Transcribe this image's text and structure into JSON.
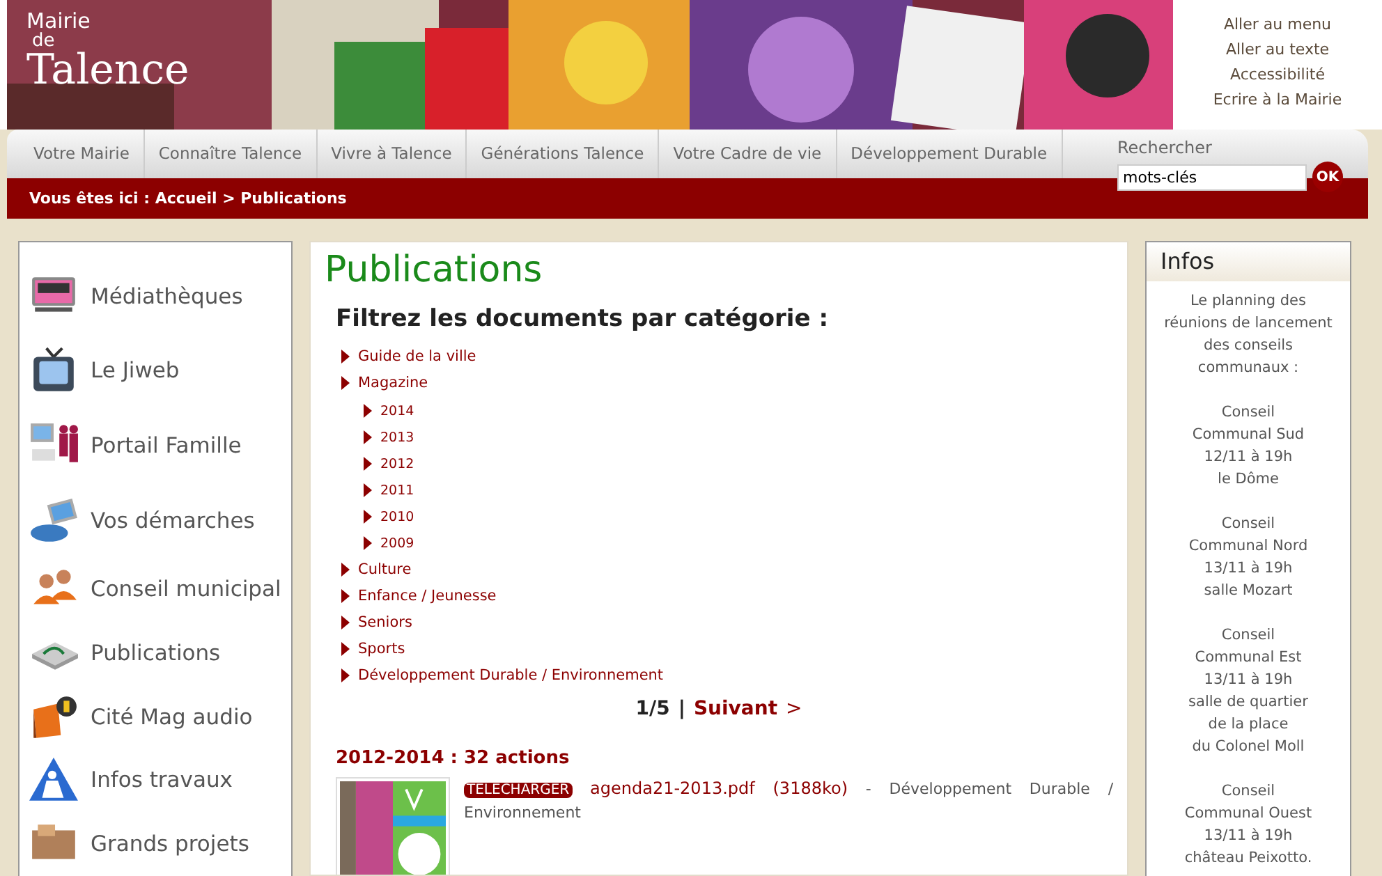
{
  "header": {
    "logo": [
      "Mairie",
      "de",
      "Talence"
    ],
    "skip_links": [
      "Aller au menu",
      "Aller au texte",
      "Accessibilité",
      "Ecrire à la Mairie"
    ]
  },
  "nav": {
    "items": [
      "Votre Mairie",
      "Connaître Talence",
      "Vivre à Talence",
      "Générations Talence",
      "Votre Cadre de vie",
      "Développement Durable"
    ],
    "search": {
      "label": "Rechercher",
      "value": "mots-clés",
      "button": "OK"
    }
  },
  "breadcrumb": {
    "prefix": "Vous êtes ici :",
    "items": [
      "Accueil",
      "Publications"
    ],
    "separator": ">"
  },
  "sidebar": {
    "items": [
      "Médiathèques",
      "Le Jiweb",
      "Portail Famille",
      "Vos démarches",
      "Conseil municipal",
      "Publications",
      "Cité Mag audio",
      "Infos travaux",
      "Grands projets"
    ]
  },
  "main": {
    "title": "Publications",
    "filter_heading": "Filtrez les documents par catégorie :",
    "categories": [
      {
        "label": "Guide de la ville"
      },
      {
        "label": "Magazine",
        "children": [
          {
            "label": "2014"
          },
          {
            "label": "2013"
          },
          {
            "label": "2012"
          },
          {
            "label": "2011"
          },
          {
            "label": "2010"
          },
          {
            "label": "2009"
          }
        ]
      },
      {
        "label": "Culture"
      },
      {
        "label": "Enfance / Jeunesse"
      },
      {
        "label": "Seniors"
      },
      {
        "label": "Sports"
      },
      {
        "label": "Développement Durable / Environnement"
      }
    ],
    "pager": {
      "page": "1/5",
      "separator": "|",
      "next": "Suivant",
      "next_arrow": ">"
    },
    "documents": [
      {
        "title": "2012-2014 : 32 actions",
        "badge": "TELECHARGER",
        "file": "agenda21-2013.pdf",
        "size": "(3188ko)",
        "description": "- Développement Durable / Environnement"
      }
    ]
  },
  "infos": {
    "title": "Infos",
    "blocks": [
      [
        "Le planning des réunions de lancement des conseils communaux :"
      ],
      [
        "Conseil",
        "Communal Sud",
        "12/11 à 19h",
        "le Dôme"
      ],
      [
        "Conseil",
        "Communal Nord",
        "13/11 à 19h",
        "salle Mozart"
      ],
      [
        "Conseil",
        "Communal Est",
        "13/11 à 19h",
        "salle de quartier",
        "de la place",
        "du Colonel Moll"
      ],
      [
        "Conseil",
        "Communal Ouest",
        "13/11 à 19h",
        "château Peixotto."
      ]
    ]
  }
}
